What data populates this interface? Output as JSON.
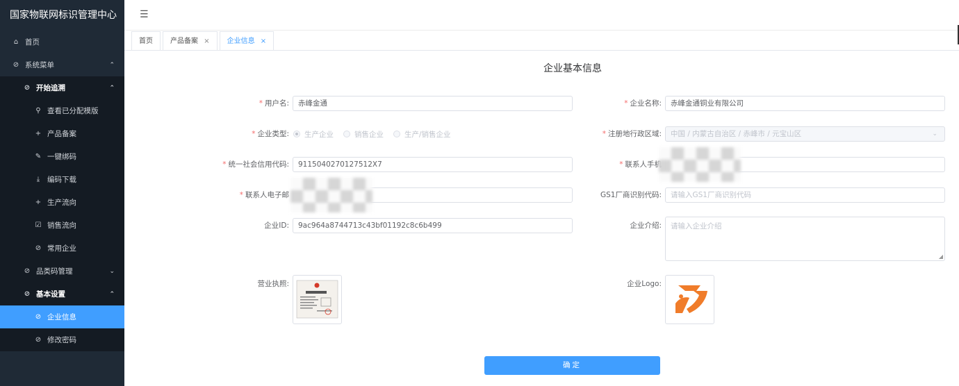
{
  "app": {
    "title": "国家物联网标识管理中心"
  },
  "sidebar": {
    "items": [
      {
        "label": "首页",
        "icon": "home-icon"
      },
      {
        "label": "系统菜单",
        "icon": "circle-check-icon"
      },
      {
        "label": "开始追溯",
        "icon": "circle-check-icon"
      },
      {
        "label": "查看已分配模版",
        "icon": "search-icon"
      },
      {
        "label": "产品备案",
        "icon": "plus-icon"
      },
      {
        "label": "一键绑码",
        "icon": "edit-icon"
      },
      {
        "label": "编码下载",
        "icon": "download-icon"
      },
      {
        "label": "生产流向",
        "icon": "plus-icon"
      },
      {
        "label": "销售流向",
        "icon": "edit-square-icon"
      },
      {
        "label": "常用企业",
        "icon": "circle-check-icon"
      },
      {
        "label": "品类码管理",
        "icon": "circle-check-icon"
      },
      {
        "label": "基本设置",
        "icon": "circle-check-icon"
      },
      {
        "label": "企业信息",
        "icon": "circle-check-icon"
      },
      {
        "label": "修改密码",
        "icon": "circle-check-icon"
      }
    ]
  },
  "tabs": [
    {
      "label": "首页"
    },
    {
      "label": "产品备案",
      "close": "×"
    },
    {
      "label": "企业信息",
      "close": "×"
    }
  ],
  "main": {
    "title": "企业基本信息",
    "required_mark": "*",
    "fields": {
      "username": {
        "label": "用户名:",
        "value": "赤峰金通"
      },
      "company_name": {
        "label": "企业名称:",
        "value": "赤峰金通铜业有限公司"
      },
      "company_type": {
        "label": "企业类型:",
        "options": [
          "生产企业",
          "销售企业",
          "生产/销售企业"
        ],
        "selected": "生产企业"
      },
      "region": {
        "label": "注册地行政区域:",
        "value": "中国 / 内蒙古自治区 / 赤峰市 / 元宝山区"
      },
      "credit_code": {
        "label": "统一社会信用代码:",
        "value": "9115040270127512X7"
      },
      "contact_phone": {
        "label": "联系人手机",
        "value": ""
      },
      "contact_email": {
        "label": "联系人电子邮",
        "value": ""
      },
      "gs1_code": {
        "label": "GS1厂商识别代码:",
        "placeholder": "请输入GS1厂商识别代码"
      },
      "company_id": {
        "label": "企业ID:",
        "value": "9ac964a8744713c43bf01192c8c6b499"
      },
      "company_intro": {
        "label": "企业介绍:",
        "placeholder": "请输入企业介绍"
      },
      "business_license": {
        "label": "营业执照:"
      },
      "company_logo": {
        "label": "企业Logo:"
      }
    },
    "confirm_button": "确定"
  },
  "colors": {
    "accent": "#409eff",
    "sidebar_bg": "#1f2a36",
    "sidebar_sub_bg": "#141b23",
    "required": "#f56c6c",
    "logo_orange": "#f07c2a"
  }
}
